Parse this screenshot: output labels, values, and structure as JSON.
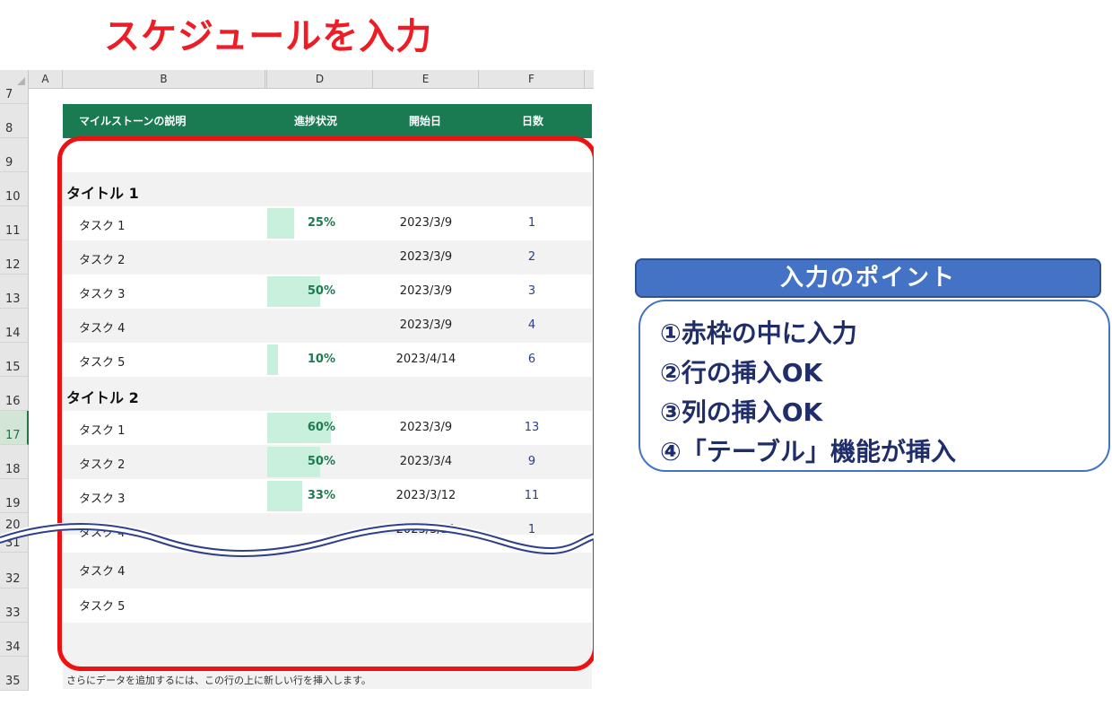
{
  "page_title": "スケジュールを入力",
  "sheet": {
    "columns": [
      "A",
      "B",
      "D",
      "E",
      "F"
    ],
    "row_numbers": [
      "7",
      "8",
      "9",
      "10",
      "11",
      "12",
      "13",
      "14",
      "15",
      "16",
      "17",
      "18",
      "19",
      "20",
      "31",
      "32",
      "33",
      "34",
      "35"
    ],
    "header": {
      "description": "マイルストーンの説明",
      "progress": "進捗状況",
      "start": "開始日",
      "days": "日数"
    },
    "titles": [
      "タイトル 1",
      "タイトル 2"
    ],
    "group1": [
      {
        "task": "タスク 1",
        "progress": "25%",
        "fill": 0.25,
        "start": "2023/3/9",
        "days": "1"
      },
      {
        "task": "タスク 2",
        "progress": "",
        "fill": 0,
        "start": "2023/3/9",
        "days": "2"
      },
      {
        "task": "タスク 3",
        "progress": "50%",
        "fill": 0.5,
        "start": "2023/3/9",
        "days": "3"
      },
      {
        "task": "タスク 4",
        "progress": "",
        "fill": 0,
        "start": "2023/3/9",
        "days": "4"
      },
      {
        "task": "タスク 5",
        "progress": "10%",
        "fill": 0.1,
        "start": "2023/4/14",
        "days": "6"
      }
    ],
    "group2": [
      {
        "task": "タスク 1",
        "progress": "60%",
        "fill": 0.6,
        "start": "2023/3/9",
        "days": "13"
      },
      {
        "task": "タスク 2",
        "progress": "50%",
        "fill": 0.5,
        "start": "2023/3/4",
        "days": "9"
      },
      {
        "task": "タスク 3",
        "progress": "33%",
        "fill": 0.33,
        "start": "2023/3/12",
        "days": "11"
      },
      {
        "task": "タスク 4",
        "progress": "",
        "fill": 0,
        "start": "2023/3/21",
        "days": "1"
      }
    ],
    "tail": [
      {
        "task": "タスク 4"
      },
      {
        "task": "タスク 5"
      }
    ],
    "footer_note": "さらにデータを追加するには、この行の上に新しい行を挿入します。"
  },
  "points": {
    "heading": "入力のポイント",
    "items": [
      "①赤枠の中に入力",
      "②行の挿入OK",
      "③列の挿入OK",
      "④「テーブル」機能が挿入"
    ]
  },
  "colors": {
    "title_red": "#ee1c24",
    "header_green": "#1a7a52",
    "bar_green": "#c9f0dd",
    "frame_red": "#ee1111",
    "point_blue": "#4472c4"
  }
}
